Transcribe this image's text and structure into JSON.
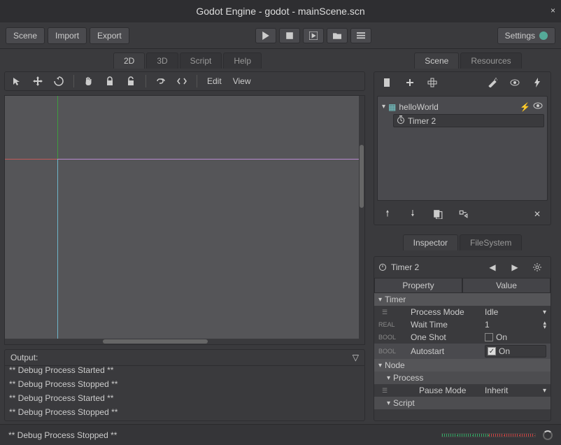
{
  "window": {
    "title": "Godot Engine - godot - mainScene.scn"
  },
  "menubar": {
    "scene": "Scene",
    "import": "Import",
    "export": "Export",
    "settings": "Settings"
  },
  "workspace_tabs": {
    "d2": "2D",
    "d3": "3D",
    "script": "Script",
    "help": "Help"
  },
  "canvas_bar": {
    "edit": "Edit",
    "view": "View"
  },
  "scene_tabs": {
    "scene": "Scene",
    "resources": "Resources"
  },
  "scene_tree": {
    "root": {
      "name": "helloWorld"
    },
    "child": {
      "name": "Timer 2",
      "icon": "timer"
    }
  },
  "inspector_tabs": {
    "inspector": "Inspector",
    "filesystem": "FileSystem"
  },
  "inspector": {
    "node_name": "Timer 2",
    "headers": {
      "property": "Property",
      "value": "Value"
    },
    "sections": {
      "timer": "Timer",
      "node": "Node",
      "process": "Process",
      "script": "Script"
    },
    "props": {
      "process_mode": {
        "label": "Process Mode",
        "value": "Idle"
      },
      "wait_time": {
        "label": "Wait Time",
        "value": "1"
      },
      "one_shot": {
        "label": "One Shot",
        "value": "On",
        "checked": false
      },
      "autostart": {
        "label": "Autostart",
        "value": "On",
        "checked": true
      },
      "pause_mode": {
        "label": "Pause Mode",
        "value": "Inherit"
      }
    }
  },
  "output": {
    "title": "Output:",
    "lines": [
      "** Debug Process Started **",
      "** Debug Process Stopped **",
      "** Debug Process Started **",
      "** Debug Process Stopped **"
    ]
  },
  "status": {
    "last_line": "** Debug Process Stopped **"
  }
}
